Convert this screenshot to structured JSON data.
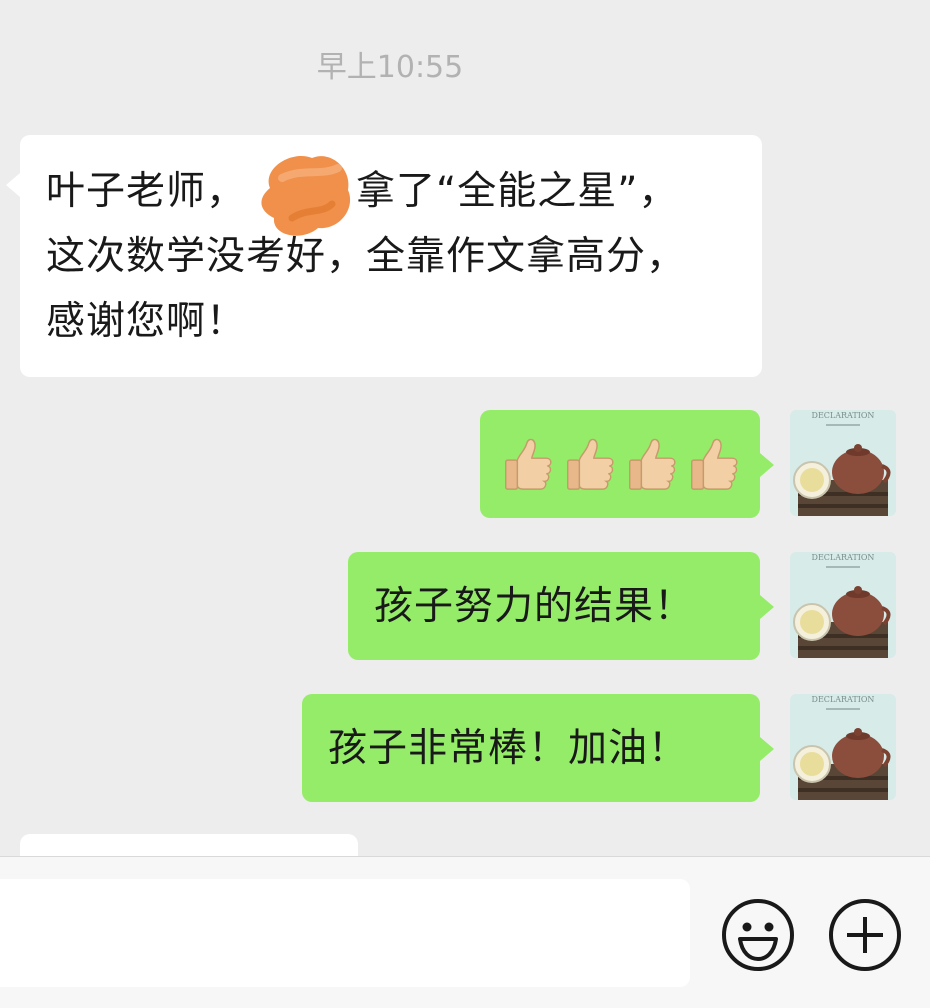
{
  "chat": {
    "timestamp": "早上10:55",
    "messages": [
      {
        "direction": "incoming",
        "lines": [
          "叶子老师，",
          "拿了“全能之星”，",
          "这次数学没考好，全靠作文拿高分，",
          "感谢您啊！"
        ]
      },
      {
        "direction": "outgoing",
        "emoji": "thumbs-up",
        "emoji_count": 4
      },
      {
        "direction": "outgoing",
        "text": "孩子努力的结果！"
      },
      {
        "direction": "outgoing",
        "text": "孩子非常棒！加油！"
      }
    ]
  },
  "avatar": {
    "book_title": "DECLARATION",
    "icon": "teapot-avatar"
  },
  "input_bar": {
    "placeholder": "",
    "emoji_icon": "smiley-icon",
    "plus_icon": "plus-circle-icon"
  },
  "colors": {
    "background": "#ededed",
    "incoming_bubble": "#ffffff",
    "outgoing_bubble": "#95ec69",
    "timestamp": "#b2b2b2",
    "redaction": "#f0904a"
  }
}
